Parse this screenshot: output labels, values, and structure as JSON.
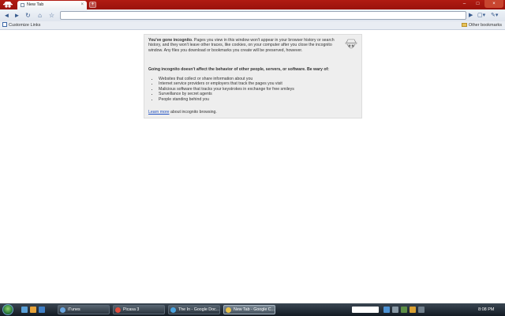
{
  "browser": {
    "tab": {
      "title": "New Tab",
      "close_glyph": "×"
    },
    "new_tab_glyph": "+",
    "window_controls": {
      "minimize": "–",
      "maximize": "□",
      "close": "×"
    },
    "toolbar": {
      "back_glyph": "◄",
      "forward_glyph": "►",
      "reload_glyph": "↻",
      "home_glyph": "⌂",
      "star_glyph": "☆",
      "go_glyph": "▶",
      "page_menu_glyph": "▢▾",
      "wrench_glyph": "✎▾",
      "omnibox_value": ""
    },
    "bookmarks_bar": {
      "left_label": "Customize Links",
      "right_label": "Other bookmarks"
    }
  },
  "incognito": {
    "intro_bold": "You've gone incognito",
    "intro_text": ". Pages you view in this window won't appear in your browser history or search history, and they won't leave other traces, like cookies, on your computer after you close the incognito window. Any files you download or bookmarks you create will be preserved, however.",
    "warning": "Going incognito doesn't affect the behavior of other people, servers, or software. Be wary of:",
    "items": [
      "Websites that collect or share information about you",
      "Internet service providers or employers that track the pages you visit",
      "Malicious software that tracks your keystrokes in exchange for free smileys",
      "Surveillance by secret agents",
      "People standing behind you"
    ],
    "learn_more": "Learn more",
    "footer_text": " about incognito browsing."
  },
  "taskbar": {
    "tasks": [
      {
        "label": "iTunes",
        "icon_color": "#6aa6e0",
        "active": false
      },
      {
        "label": "Picasa 3",
        "icon_color": "#e04d3c",
        "active": false
      },
      {
        "label": "The In - Google Doc...",
        "icon_color": "#4aa3df",
        "active": false
      },
      {
        "label": "New Tab - Google C...",
        "icon_color": "#e9c24a",
        "active": true
      }
    ],
    "clock": "8:08 PM"
  },
  "colors": {
    "titlebar": "#9a120c",
    "panel_bg": "#eeeeee",
    "link": "#1e4fc2"
  }
}
